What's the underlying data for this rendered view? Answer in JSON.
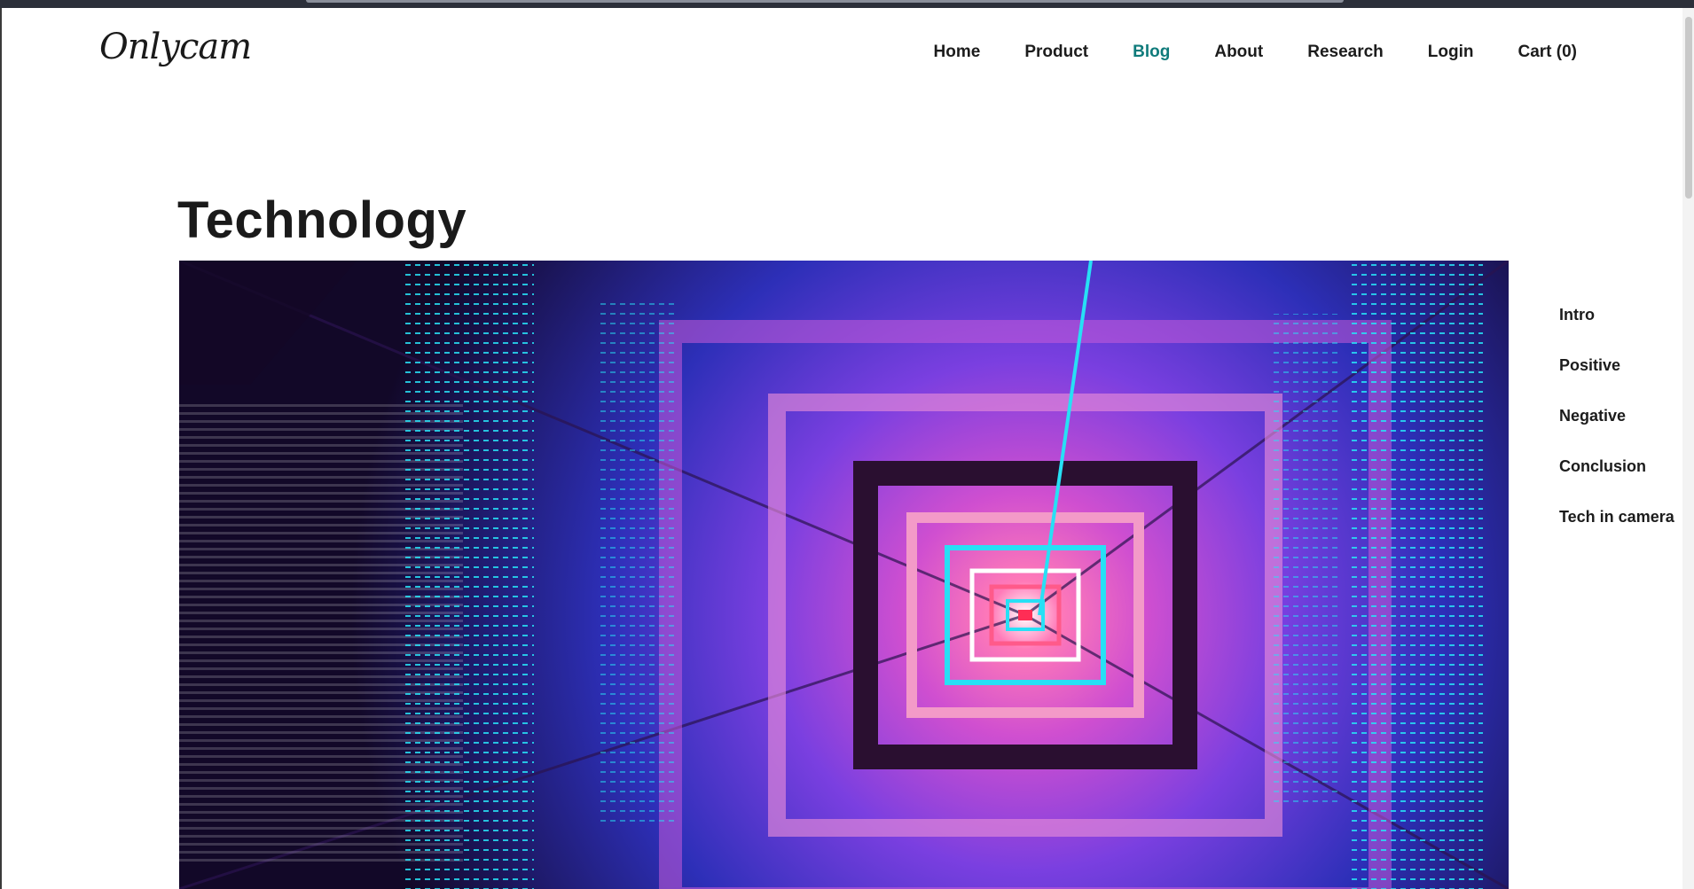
{
  "header": {
    "logo_text": "Onlycam",
    "nav": [
      {
        "label": "Home",
        "active": false
      },
      {
        "label": "Product",
        "active": false
      },
      {
        "label": "Blog",
        "active": true
      },
      {
        "label": "About",
        "active": false
      },
      {
        "label": "Research",
        "active": false
      },
      {
        "label": "Login",
        "active": false
      },
      {
        "label": "Cart (0)",
        "active": false
      }
    ]
  },
  "main": {
    "title": "Technology"
  },
  "toc": {
    "items": [
      "Intro",
      "Positive",
      "Negative",
      "Conclusion",
      "Tech in camera"
    ]
  },
  "colors": {
    "accent": "#0f7b7b",
    "text": "#1c1c1c",
    "hero_pink": "#e36bd6",
    "hero_blue": "#3f5bff",
    "hero_cyan": "#27e0f5"
  }
}
